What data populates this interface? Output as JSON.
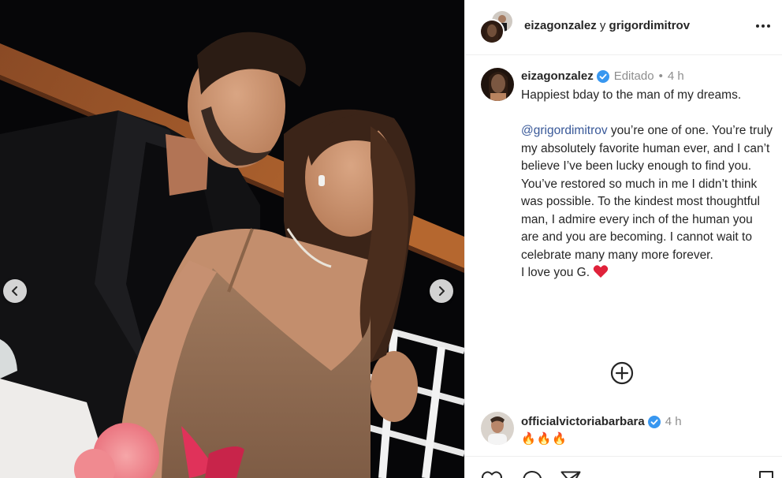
{
  "header": {
    "author": "eizagonzalez",
    "connector": " y ",
    "coauthor": "grigordimitrov"
  },
  "caption": {
    "username": "eizagonzalez",
    "edited": "Editado",
    "separator": "•",
    "time": "4 h",
    "line1": "Happiest bday to the man of my dreams.",
    "mention": "@grigordimitrov",
    "body": " you’re one of one. You’re truly my absolutely favorite human ever, and I can’t believe I’ve been lucky enough to find you. You’ve restored so much in me I didn’t think was possible. To the kindest most thoughtful man, I admire every inch of the human you are and you are becoming. I cannot wait to celebrate many many more forever.",
    "closing": "I love you G."
  },
  "comments": [
    {
      "username": "officialvictoriabarbara",
      "time": "4 h",
      "text": "🔥🔥🔥"
    }
  ],
  "icons": {
    "more": "more-options-icon",
    "verified": "verified-badge-icon",
    "heart": "red-heart-emoji",
    "add_comment": "plus-circle-icon",
    "like": "heart-outline-icon",
    "comment": "comment-bubble-icon",
    "share": "paper-plane-icon",
    "save": "bookmark-icon",
    "prev": "chevron-left-icon",
    "next": "chevron-right-icon"
  },
  "colors": {
    "verified": "#3897f0",
    "mention": "#385898",
    "heart": "#ed4956",
    "meta": "#8e8e8e",
    "text": "#262626"
  }
}
